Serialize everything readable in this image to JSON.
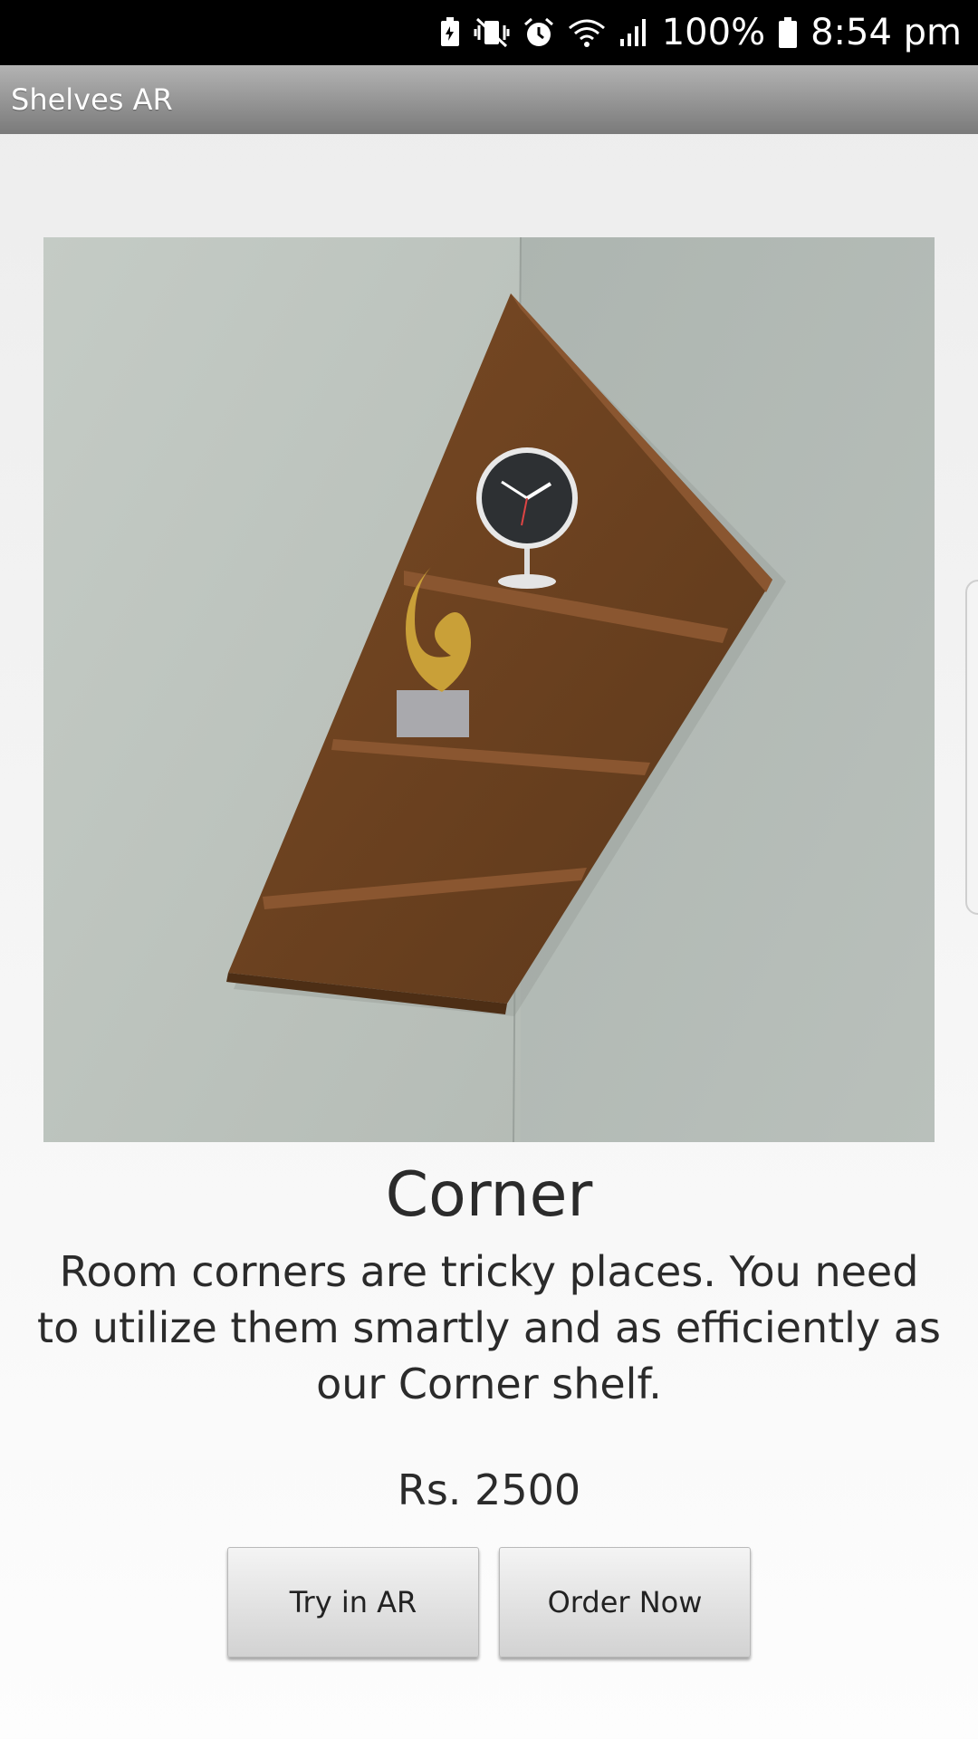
{
  "status_bar": {
    "battery_percent": "100%",
    "time": "8:54 pm",
    "icons": [
      "battery-saver-icon",
      "mute-vibrate-icon",
      "alarm-icon",
      "wifi-icon",
      "signal-icon",
      "battery-icon"
    ]
  },
  "app_bar": {
    "title": "Shelves AR"
  },
  "product": {
    "name": "Corner",
    "description": "Room corners are tricky places. You need to utilize them smartly and as efficiently as our Corner shelf.",
    "price": "Rs. 2500",
    "image": "corner-shelf-photo"
  },
  "actions": {
    "try_ar_label": "Try in AR",
    "order_label": "Order Now"
  },
  "colors": {
    "status_bar": "#000000",
    "app_bar": "#8f8f8f",
    "wood": "#6e4423",
    "wall": "#bcc3bd"
  }
}
